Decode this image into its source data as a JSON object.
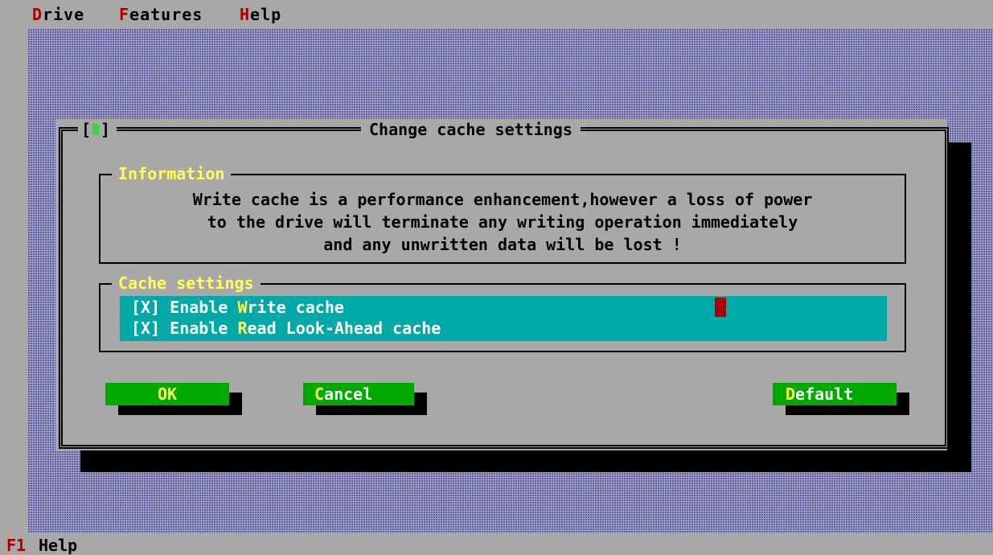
{
  "menubar": {
    "items": [
      {
        "hotkey": "D",
        "rest": "rive"
      },
      {
        "hotkey": "F",
        "rest": "eatures"
      },
      {
        "hotkey": "H",
        "rest": "elp"
      }
    ]
  },
  "dialog": {
    "close_open": "[",
    "close_close": "]",
    "title": "Change cache settings",
    "info": {
      "label": "Information",
      "lines": [
        "Write cache is a performance enhancement,however a loss of power",
        "to the drive will terminate any writing operation immediately",
        "and any unwritten data will be lost !"
      ]
    },
    "cache": {
      "label": "Cache settings",
      "items": [
        {
          "prefix": "[X] Enable ",
          "hotkey": "W",
          "rest": "rite cache",
          "checked": true
        },
        {
          "prefix": "[X] Enable ",
          "hotkey": "R",
          "rest": "ead Look-Ahead cache",
          "checked": true
        }
      ]
    },
    "buttons": {
      "ok": {
        "prefix": "",
        "hotkey": "OK",
        "rest": ""
      },
      "cancel": {
        "prefix": "",
        "hotkey": "C",
        "rest": "ancel"
      },
      "default": {
        "prefix": "",
        "hotkey": "D",
        "rest": "efault"
      }
    }
  },
  "statusbar": {
    "key": "F1",
    "label": "Help"
  },
  "colors": {
    "background": "#a8a8a8",
    "desktop_pattern": "#5454c8",
    "hotkey_red": "#a80000",
    "label_yellow": "#ffff54",
    "list_cyan": "#00a8a8",
    "button_green": "#00a800"
  }
}
